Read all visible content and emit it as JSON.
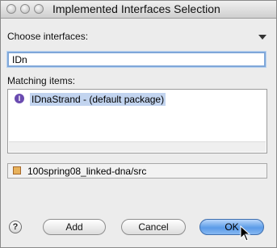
{
  "window": {
    "title": "Implemented Interfaces Selection"
  },
  "labels": {
    "choose": "Choose interfaces:",
    "matching": "Matching items:"
  },
  "search": {
    "value": "IDn"
  },
  "matches": [
    {
      "text": "IDnaStrand - (default package)",
      "icon": "interface-icon",
      "selected": true
    }
  ],
  "status": {
    "text": "100spring08_linked-dna/src",
    "icon": "package-folder-icon"
  },
  "buttons": {
    "help": "?",
    "add": "Add",
    "cancel": "Cancel",
    "ok": "OK"
  },
  "colors": {
    "selection": "#c2d4ef",
    "default_button": "#5b9be8",
    "focus_ring": "#7fa7d9"
  }
}
